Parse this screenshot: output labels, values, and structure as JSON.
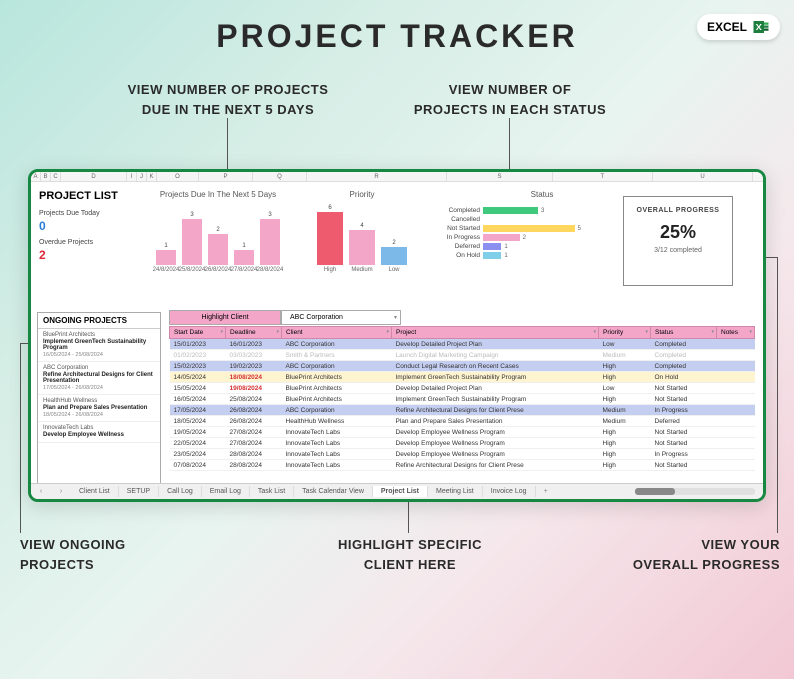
{
  "title": "PROJECT TRACKER",
  "excel_badge": "EXCEL",
  "annotations": {
    "top_left": "VIEW NUMBER OF PROJECTS\nDUE IN THE NEXT 5 DAYS",
    "top_right": "VIEW NUMBER OF\nPROJECTS IN EACH STATUS",
    "bottom_left": "VIEW ONGOING\nPROJECTS",
    "bottom_center": "HIGHLIGHT SPECIFIC\nCLIENT HERE",
    "bottom_right": "VIEW YOUR\nOVERALL PROGRESS"
  },
  "col_headers": [
    "A",
    "B",
    "C",
    "D",
    "I",
    "J",
    "K",
    "O",
    "P",
    "Q",
    "R",
    "S",
    "T",
    "U"
  ],
  "project_list_title": "PROJECT LIST",
  "stats": {
    "due_today_label": "Projects Due Today",
    "due_today_value": "0",
    "overdue_label": "Overdue Projects",
    "overdue_value": "2"
  },
  "chart_data": [
    {
      "type": "bar",
      "title": "Projects Due In The Next 5 Days",
      "categories": [
        "24/8/2024",
        "25/8/2024",
        "26/8/2024",
        "27/8/2024",
        "28/8/2024"
      ],
      "values": [
        1,
        3,
        2,
        1,
        3
      ],
      "colors": [
        "#f4a6c9",
        "#f4a6c9",
        "#f4a6c9",
        "#f4a6c9",
        "#f4a6c9"
      ],
      "ylim": [
        0,
        4
      ]
    },
    {
      "type": "bar",
      "title": "Priority",
      "categories": [
        "High",
        "Medium",
        "Low"
      ],
      "values": [
        6,
        4,
        2
      ],
      "colors": [
        "#ef5b6e",
        "#f4a6c9",
        "#7db9e8"
      ],
      "ylim": [
        0,
        7
      ]
    },
    {
      "type": "bar",
      "orientation": "horizontal",
      "title": "Status",
      "categories": [
        "Completed",
        "Cancelled",
        "Not Started",
        "In Progress",
        "Deferred",
        "On Hold"
      ],
      "values": [
        3,
        0,
        5,
        2,
        1,
        1
      ],
      "colors": [
        "#3fc97d",
        "#888",
        "#ffd75e",
        "#f4a6c9",
        "#8a8ff0",
        "#7fcfe8"
      ],
      "xlim": [
        0,
        6
      ]
    }
  ],
  "progress": {
    "title": "OVERALL PROGRESS",
    "pct": "25%",
    "sub": "3/12 completed"
  },
  "ongoing": {
    "title": "ONGOING PROJECTS",
    "items": [
      {
        "client": "BluePrint Architects",
        "project": "Implement GreenTech Sustainability Program",
        "dates": "16/05/2024 - 25/08/2024"
      },
      {
        "client": "ABC Corporation",
        "project": "Refine Architectural Designs for Client Presentation",
        "dates": "17/05/2024 - 26/08/2024"
      },
      {
        "client": "HealthHub Wellness",
        "project": "Plan and Prepare Sales Presentation",
        "dates": "18/05/2024 - 26/08/2024"
      },
      {
        "client": "InnovateTech Labs",
        "project": "Develop Employee Wellness",
        "dates": ""
      }
    ]
  },
  "highlight": {
    "button": "Highlight Client",
    "selected": "ABC Corporation"
  },
  "table": {
    "headers": [
      "Start Date",
      "Deadline",
      "Client",
      "Project",
      "Priority",
      "Status",
      "Notes"
    ],
    "rows": [
      {
        "cls": "hl",
        "cells": [
          "15/01/2023",
          "16/01/2023",
          "ABC Corporation",
          "Develop Detailed Project Plan",
          "Low",
          "Completed",
          ""
        ]
      },
      {
        "cls": "dim",
        "cells": [
          "01/02/2023",
          "03/03/2023",
          "Smith & Partners",
          "Launch Digital Marketing Campaign",
          "Medium",
          "Completed",
          ""
        ]
      },
      {
        "cls": "hl",
        "cells": [
          "15/02/2023",
          "19/02/2023",
          "ABC Corporation",
          "Conduct Legal Research on Recent Cases",
          "High",
          "Completed",
          ""
        ]
      },
      {
        "cls": "yel",
        "cells": [
          "14/05/2024",
          "18/08/2024",
          "BluePrint Architects",
          "Implement GreenTech Sustainability Program",
          "High",
          "On Hold",
          ""
        ],
        "red": 1
      },
      {
        "cls": "",
        "cells": [
          "15/05/2024",
          "19/08/2024",
          "BluePrint Architects",
          "Develop Detailed Project Plan",
          "Low",
          "Not Started",
          ""
        ],
        "red": 1
      },
      {
        "cls": "",
        "cells": [
          "16/05/2024",
          "25/08/2024",
          "BluePrint Architects",
          "Implement GreenTech Sustainability Program",
          "High",
          "Not Started",
          ""
        ]
      },
      {
        "cls": "hl",
        "cells": [
          "17/05/2024",
          "26/08/2024",
          "ABC Corporation",
          "Refine Architectural Designs for Client Prese",
          "Medium",
          "In Progress",
          ""
        ]
      },
      {
        "cls": "",
        "cells": [
          "18/05/2024",
          "26/08/2024",
          "HealthHub Wellness",
          "Plan and Prepare Sales Presentation",
          "Medium",
          "Deferred",
          ""
        ]
      },
      {
        "cls": "",
        "cells": [
          "19/05/2024",
          "27/08/2024",
          "InnovateTech Labs",
          "Develop Employee Wellness Program",
          "High",
          "Not Started",
          ""
        ]
      },
      {
        "cls": "",
        "cells": [
          "22/05/2024",
          "27/08/2024",
          "InnovateTech Labs",
          "Develop Employee Wellness Program",
          "High",
          "Not Started",
          ""
        ]
      },
      {
        "cls": "",
        "cells": [
          "23/05/2024",
          "28/08/2024",
          "InnovateTech Labs",
          "Develop Employee Wellness Program",
          "High",
          "In Progress",
          ""
        ]
      },
      {
        "cls": "",
        "cells": [
          "07/08/2024",
          "28/08/2024",
          "InnovateTech Labs",
          "Refine Architectural Designs for Client Prese",
          "High",
          "Not Started",
          ""
        ]
      }
    ]
  },
  "tabs": [
    "Client List",
    "SETUP",
    "Call Log",
    "Email Log",
    "Task List",
    "Task Calendar View",
    "Project List",
    "Meeting List",
    "Invoice Log"
  ],
  "active_tab": 6
}
